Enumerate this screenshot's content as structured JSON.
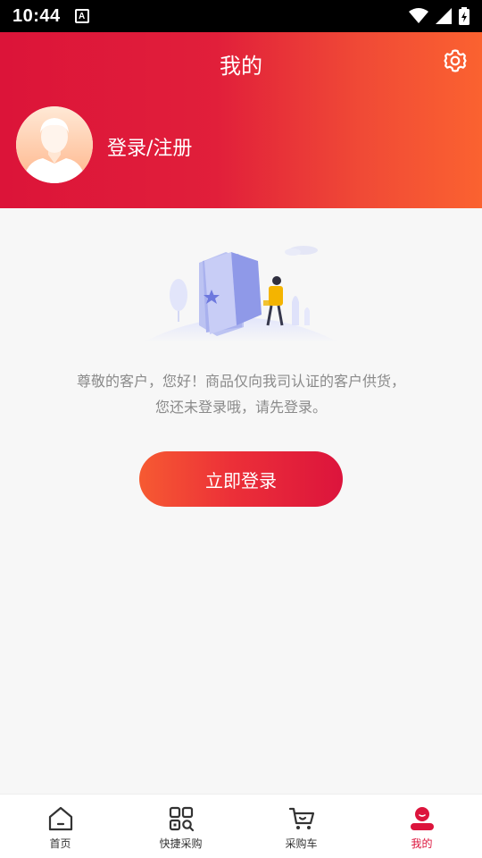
{
  "status_bar": {
    "time": "10:44",
    "notification_badge": "A",
    "icons": [
      "wifi-icon",
      "signal-icon",
      "battery-icon"
    ]
  },
  "header": {
    "title": "我的",
    "settings_icon": "gear-icon",
    "avatar_icon": "default-avatar",
    "login_link": "登录/注册"
  },
  "main": {
    "illustration": "empty-state-illustration",
    "notice": "尊敬的客户，您好！商品仅向我司认证的客户供货，您还未登录哦，请先登录。",
    "login_button": "立即登录"
  },
  "tabbar": {
    "items": [
      {
        "label": "首页",
        "icon": "home-icon",
        "active": false
      },
      {
        "label": "快捷采购",
        "icon": "quick-purchase-icon",
        "active": false
      },
      {
        "label": "采购车",
        "icon": "cart-icon",
        "active": false
      },
      {
        "label": "我的",
        "icon": "profile-icon",
        "active": true
      }
    ]
  },
  "colors": {
    "brand_red": "#dc143c",
    "brand_orange": "#fb6230",
    "text_gray": "#8a8a8a",
    "tab_active": "#dc143c"
  }
}
